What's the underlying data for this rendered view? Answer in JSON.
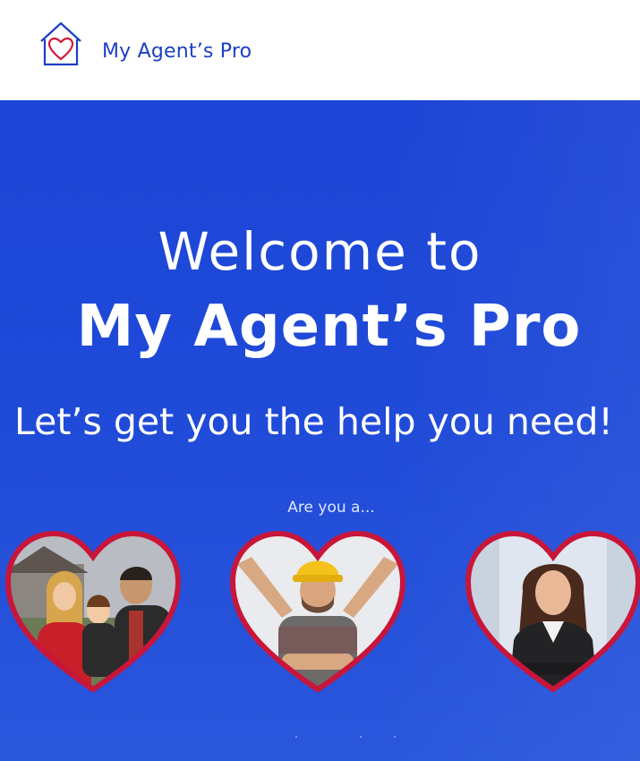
{
  "header": {
    "brand_name": "My Agent’s Pro",
    "logo_icon": "house-heart-icon"
  },
  "hero": {
    "welcome_text": "Welcome to",
    "brand_title": "My Agent’s Pro",
    "tagline": "Let’s get you the help you need!",
    "prompt": "Are you a..."
  },
  "options": [
    {
      "icon": "family-photo"
    },
    {
      "icon": "contractor-photo"
    },
    {
      "icon": "agent-photo"
    }
  ],
  "colors": {
    "brand_blue": "#1c3fc4",
    "hero_blue": "#1f4ad8",
    "heart_border": "#c8163a"
  }
}
